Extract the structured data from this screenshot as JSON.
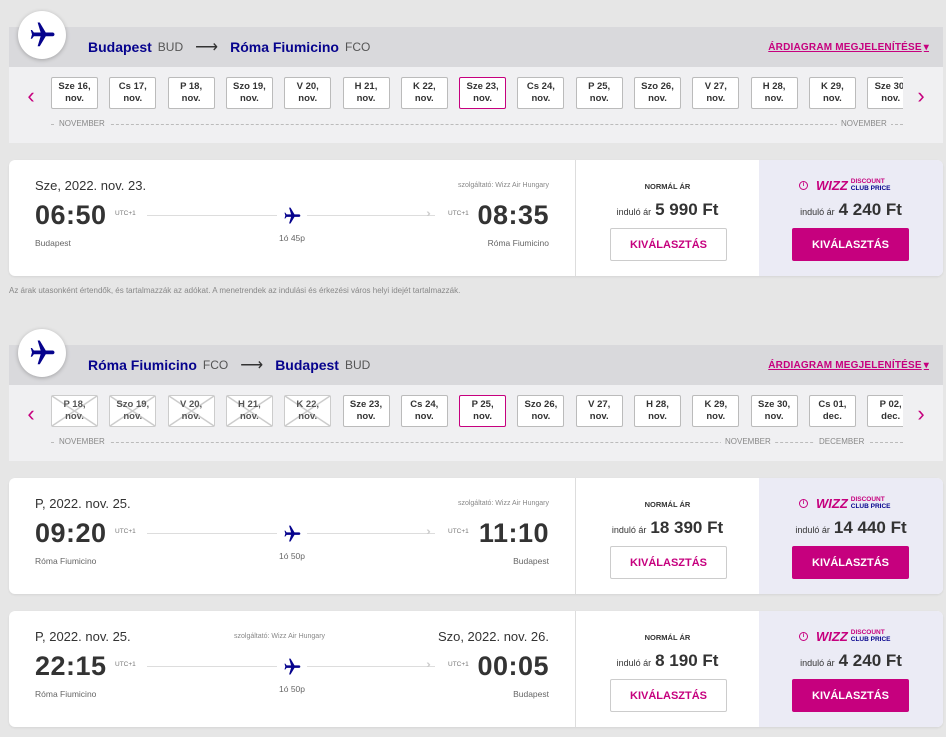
{
  "sections": [
    {
      "origin_city": "Budapest",
      "origin_code": "BUD",
      "dest_city": "Róma Fiumicino",
      "dest_code": "FCO",
      "chart_link": "ÁRDIAGRAM MEGJELENÍTÉSE",
      "months": [
        "NOVEMBER",
        "NOVEMBER"
      ],
      "dates": [
        {
          "d": "Sze 16,",
          "m": "nov."
        },
        {
          "d": "Cs 17,",
          "m": "nov."
        },
        {
          "d": "P 18,",
          "m": "nov."
        },
        {
          "d": "Szo 19,",
          "m": "nov."
        },
        {
          "d": "V 20,",
          "m": "nov."
        },
        {
          "d": "H 21,",
          "m": "nov."
        },
        {
          "d": "K 22,",
          "m": "nov."
        },
        {
          "d": "Sze 23,",
          "m": "nov."
        },
        {
          "d": "Cs 24,",
          "m": "nov."
        },
        {
          "d": "P 25,",
          "m": "nov."
        },
        {
          "d": "Szo 26,",
          "m": "nov."
        },
        {
          "d": "V 27,",
          "m": "nov."
        },
        {
          "d": "H 28,",
          "m": "nov."
        },
        {
          "d": "K 29,",
          "m": "nov."
        },
        {
          "d": "Sze 30,",
          "m": "nov."
        }
      ]
    },
    {
      "origin_city": "Róma Fiumicino",
      "origin_code": "FCO",
      "dest_city": "Budapest",
      "dest_code": "BUD",
      "chart_link": "ÁRDIAGRAM MEGJELENÍTÉSE",
      "months": [
        "NOVEMBER",
        "NOVEMBER",
        "DECEMBER"
      ],
      "dates": [
        {
          "d": "P 18,",
          "m": "nov."
        },
        {
          "d": "Szo 19,",
          "m": "nov."
        },
        {
          "d": "V 20,",
          "m": "nov."
        },
        {
          "d": "H 21,",
          "m": "nov."
        },
        {
          "d": "K 22,",
          "m": "nov."
        },
        {
          "d": "Sze 23,",
          "m": "nov."
        },
        {
          "d": "Cs 24,",
          "m": "nov."
        },
        {
          "d": "P 25,",
          "m": "nov."
        },
        {
          "d": "Szo 26,",
          "m": "nov."
        },
        {
          "d": "V 27,",
          "m": "nov."
        },
        {
          "d": "H 28,",
          "m": "nov."
        },
        {
          "d": "K 29,",
          "m": "nov."
        },
        {
          "d": "Sze 30,",
          "m": "nov."
        },
        {
          "d": "Cs 01,",
          "m": "dec."
        },
        {
          "d": "P 02,",
          "m": "dec."
        }
      ]
    }
  ],
  "flights": [
    {
      "date": "Sze, 2022. nov. 23.",
      "arr_date": "",
      "operator": "szolgáltató: Wizz Air Hungary",
      "dep_time": "06:50",
      "arr_time": "08:35",
      "utc": "UTC+1",
      "dep_place": "Budapest",
      "arr_place": "Róma Fiumicino",
      "duration": "1ó 45p",
      "normal_label": "NORMÁL ÁR",
      "from_label": "induló ár",
      "normal_price": "5 990 Ft",
      "club_price": "4 240 Ft",
      "select_label": "KIVÁLASZTÁS"
    },
    {
      "date": "P, 2022. nov. 25.",
      "arr_date": "",
      "operator": "szolgáltató: Wizz Air Hungary",
      "dep_time": "09:20",
      "arr_time": "11:10",
      "utc": "UTC+1",
      "dep_place": "Róma Fiumicino",
      "arr_place": "Budapest",
      "duration": "1ó 50p",
      "normal_label": "NORMÁL ÁR",
      "from_label": "induló ár",
      "normal_price": "18 390 Ft",
      "club_price": "14 440 Ft",
      "select_label": "KIVÁLASZTÁS"
    },
    {
      "date": "P, 2022. nov. 25.",
      "arr_date": "Szo, 2022. nov. 26.",
      "operator": "szolgáltató: Wizz Air Hungary",
      "dep_time": "22:15",
      "arr_time": "00:05",
      "utc": "UTC+1",
      "dep_place": "Róma Fiumicino",
      "arr_place": "Budapest",
      "duration": "1ó 50p",
      "normal_label": "NORMÁL ÁR",
      "from_label": "induló ár",
      "normal_price": "8 190 Ft",
      "club_price": "4 240 Ft",
      "select_label": "KIVÁLASZTÁS"
    }
  ],
  "club": {
    "logo": "WIZZ",
    "line1": "DISCOUNT",
    "line2": "CLUB",
    "line3": "PRICE",
    "info": "i"
  },
  "disclaimer": "Az árak utasonként értendők, és tartalmazzák az adókat. A menetrendek az indulási és érkezési város helyi idejét tartalmazzák.",
  "icons": {
    "plane": "plane-icon",
    "prev": "‹",
    "next": "›",
    "route_arrow": "⟶",
    "caret": "▾"
  },
  "colors": {
    "brand_magenta": "#c6007e",
    "brand_navy": "#06038d"
  }
}
